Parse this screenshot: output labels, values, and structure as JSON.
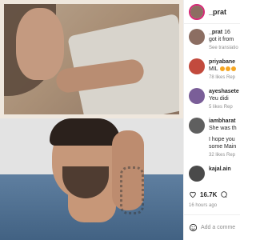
{
  "post": {
    "username": "_prat",
    "media_description_top": "",
    "media_description_bottom": ""
  },
  "comments": [
    {
      "username": "_prat",
      "text_line1": "16",
      "text_line2": "got it from",
      "translation": "See translatio"
    },
    {
      "username": "priyabane",
      "text_line1": "MIL",
      "likes": "78 likes",
      "reply": "Rep"
    },
    {
      "username": "ayeshasete",
      "text_line1": "Yeu didi",
      "likes": "5 likes",
      "reply": "Rep"
    },
    {
      "username": "iambharat",
      "text_line1": "She was th",
      "text_line2": "I hope you",
      "text_line3": "some Main",
      "likes": "32 likes",
      "reply": "Rep"
    },
    {
      "username": "kajal.ain",
      "text_line1": ""
    }
  ],
  "actions": {
    "like_count": "16.7K",
    "time_ago": "16 hours ago"
  },
  "composer": {
    "placeholder": "Add a comme"
  },
  "icons": {
    "like": "heart-icon",
    "comment": "comment-icon",
    "emoji": "emoji-icon"
  },
  "colors": {
    "story_ring": "#d62976",
    "muted_text": "#8e8e8e"
  }
}
